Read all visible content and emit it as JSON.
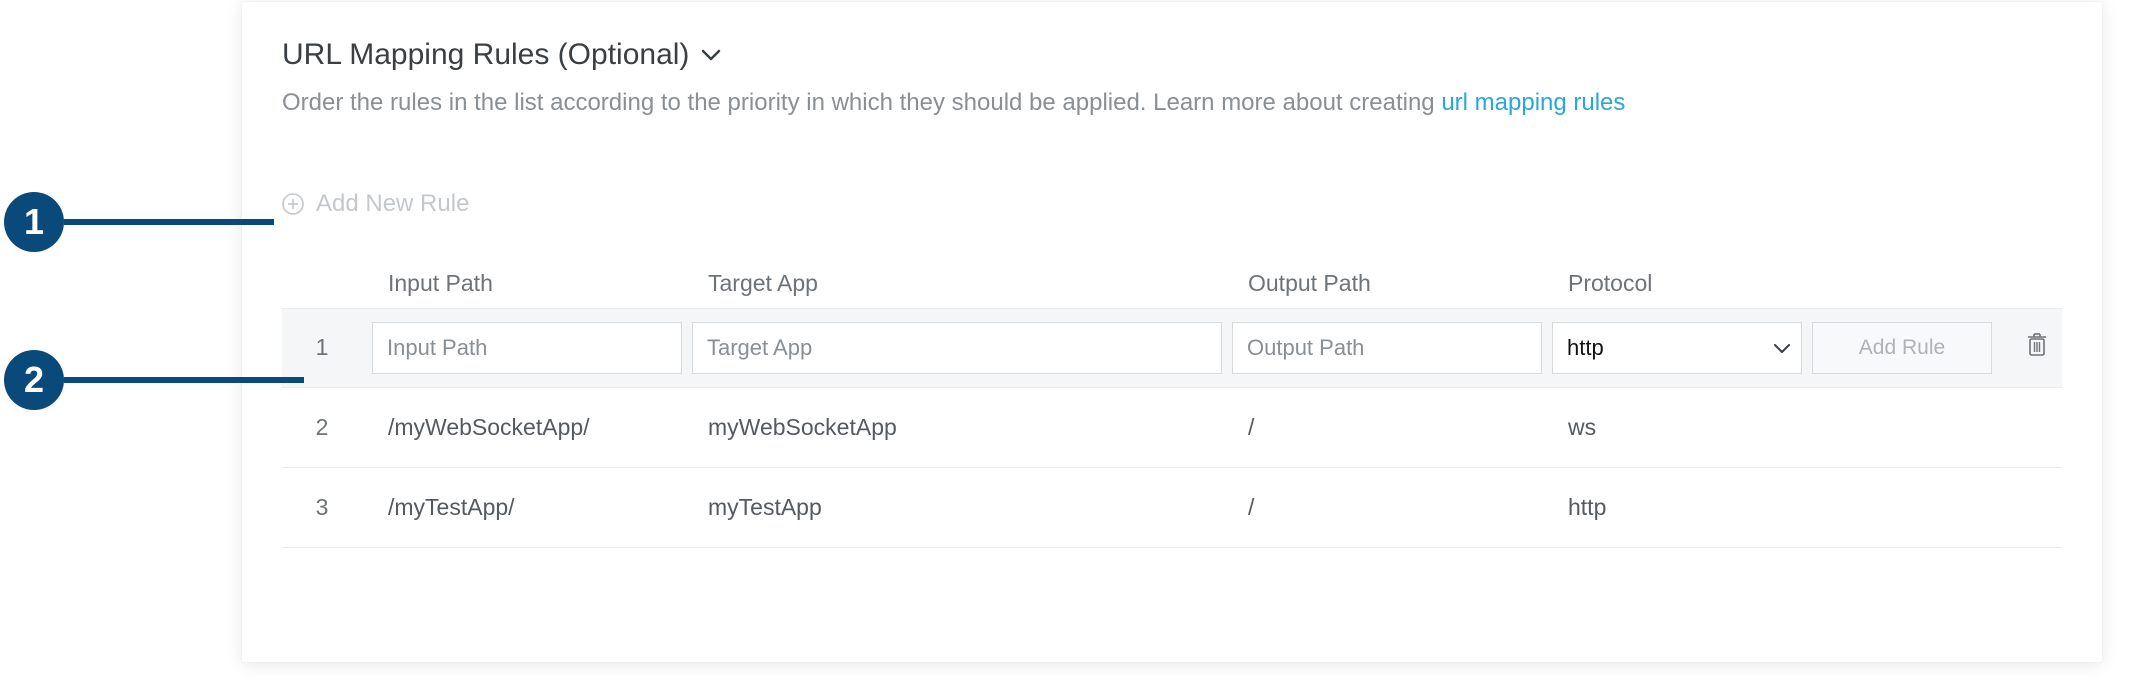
{
  "callouts": {
    "one": "1",
    "two": "2"
  },
  "section": {
    "title": "URL Mapping Rules (Optional)",
    "desc_prefix": "Order the rules in the list according to the priority in which they should be applied. Learn more about creating ",
    "desc_link": "url mapping rules"
  },
  "addRule": {
    "label": "Add New Rule"
  },
  "columns": {
    "input_path": "Input Path",
    "target_app": "Target App",
    "output_path": "Output Path",
    "protocol": "Protocol"
  },
  "editRow": {
    "index": "1",
    "input_placeholder": "Input Path",
    "target_placeholder": "Target App",
    "output_placeholder": "Output Path",
    "protocol_value": "http",
    "add_button": "Add Rule"
  },
  "rows": [
    {
      "index": "2",
      "input": "/myWebSocketApp/",
      "target": "myWebSocketApp",
      "output": "/",
      "protocol": "ws"
    },
    {
      "index": "3",
      "input": "/myTestApp/",
      "target": "myTestApp",
      "output": "/",
      "protocol": "http"
    }
  ]
}
